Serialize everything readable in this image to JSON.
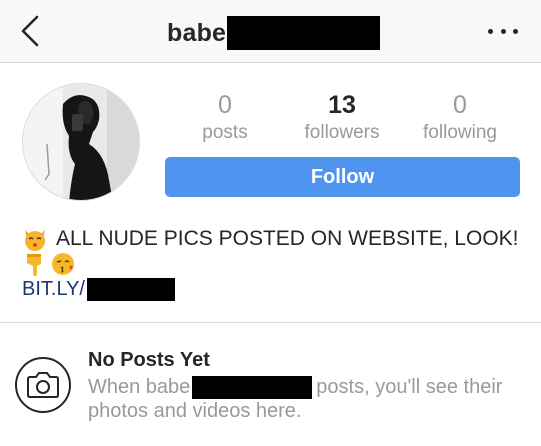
{
  "header": {
    "back_icon": "chevron-left-icon",
    "username_visible": "babe",
    "more_icon": "ellipsis-icon"
  },
  "profile": {
    "avatar_icon": "profile-photo",
    "stats": {
      "posts": {
        "value": "0",
        "label": "posts"
      },
      "followers": {
        "value": "13",
        "label": "followers"
      },
      "following": {
        "value": "0",
        "label": "following"
      }
    },
    "follow_label": "Follow"
  },
  "bio": {
    "line1_emoji": "kissing-cat-emoji",
    "line1_text": "ALL NUDE PICS POSTED ON WEBSITE, LOOK!",
    "line2_emojis": [
      "point-down-emoji",
      "kiss-face-emoji"
    ],
    "link_visible": "BIT.LY/"
  },
  "empty_state": {
    "icon": "camera-icon",
    "title": "No Posts Yet",
    "line1_before": "When babe",
    "line1_after": "posts, you'll see their",
    "line2": "photos and videos here."
  },
  "colors": {
    "follow_button": "#4f95f0",
    "link": "#1d3a70",
    "muted_text": "#999999",
    "redaction": "#000000"
  }
}
